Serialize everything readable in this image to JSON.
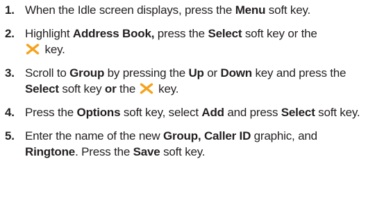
{
  "nav_key_icon": "navigation-center-key-icon",
  "nav_key_color": "#f5a21b",
  "steps": [
    {
      "num": "1.",
      "t1": "When the Idle screen displays, press the ",
      "b1": "Menu",
      "t2": " soft key."
    },
    {
      "num": "2.",
      "t1": "Highlight ",
      "b1": "Address Book,",
      "t2": " press the ",
      "b2": "Select",
      "t3": " soft key or the",
      "t4": " key."
    },
    {
      "num": "3.",
      "t1": "Scroll to ",
      "b1": "Group",
      "t2": " by pressing the ",
      "b2": "Up",
      "t3": " or ",
      "b3": "Down",
      "t4": " key and press the ",
      "b4": "Select",
      "t5": " soft key ",
      "b5": "or",
      "t6": " the ",
      "t7": " key."
    },
    {
      "num": "4.",
      "t1": "Press the ",
      "b1": "Options",
      "t2": " soft key, select ",
      "b2": "Add",
      "t3": " and press ",
      "b3": "Select",
      "t4": " soft key."
    },
    {
      "num": "5.",
      "t1": "Enter the name of the new ",
      "b1": "Group, Caller ID",
      "t2": " graphic, and ",
      "b2": "Ringtone",
      "t3": ". Press the ",
      "b3": "Save",
      "t4": " soft key."
    }
  ]
}
